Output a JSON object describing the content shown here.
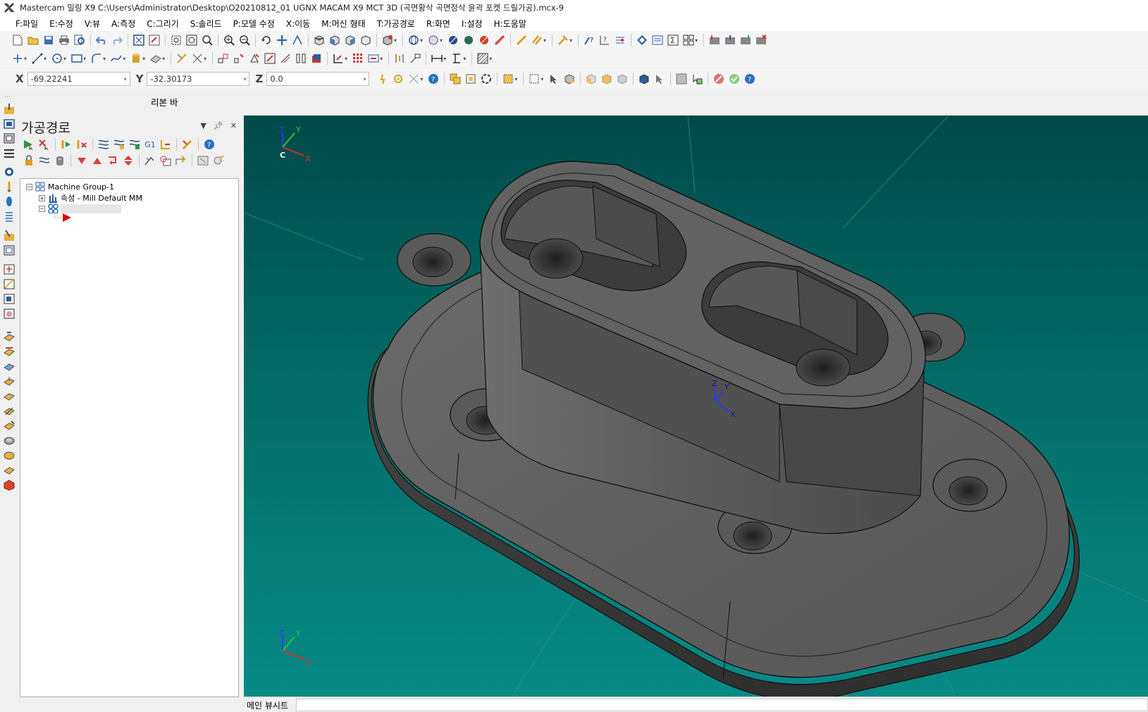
{
  "window": {
    "title": "Mastercam 밀링 X9  C:\\Users\\Administrator\\Desktop\\O20210812_01 UGNX MACAM X9 MCT 3D (곡면황삭 곡면정삭 윤곽 포켓 드릴가공).mcx-9"
  },
  "menu": {
    "items": [
      "F:파일",
      "E:수정",
      "V:뷰",
      "A:측정",
      "C:그리기",
      "S:솔리드",
      "P:모델 수정",
      "X:이동",
      "M:머신 형태",
      "T:가공경로",
      "R:화면",
      "I:설정",
      "H:도움말"
    ]
  },
  "coords": {
    "x_label": "X",
    "x_value": "-69.22241",
    "y_label": "Y",
    "y_value": "-32.30173",
    "z_label": "Z",
    "z_value": "0.0"
  },
  "ribbon": {
    "label": "리본 바"
  },
  "panel": {
    "title": "가공경로",
    "g1_label": "G1",
    "tree": {
      "machine_group": "Machine Group-1",
      "properties": "속성 - Mill Default MM"
    }
  },
  "viewport": {
    "gnomon": {
      "x": "X",
      "y": "Y",
      "z": "Z",
      "c": "C"
    },
    "colors": {
      "bg_top": "#004a48",
      "bg_bottom": "#078a86",
      "part": "#5c5c5c",
      "edge": "#111111"
    }
  },
  "status": {
    "tab_label": "메인 뷰시트"
  }
}
